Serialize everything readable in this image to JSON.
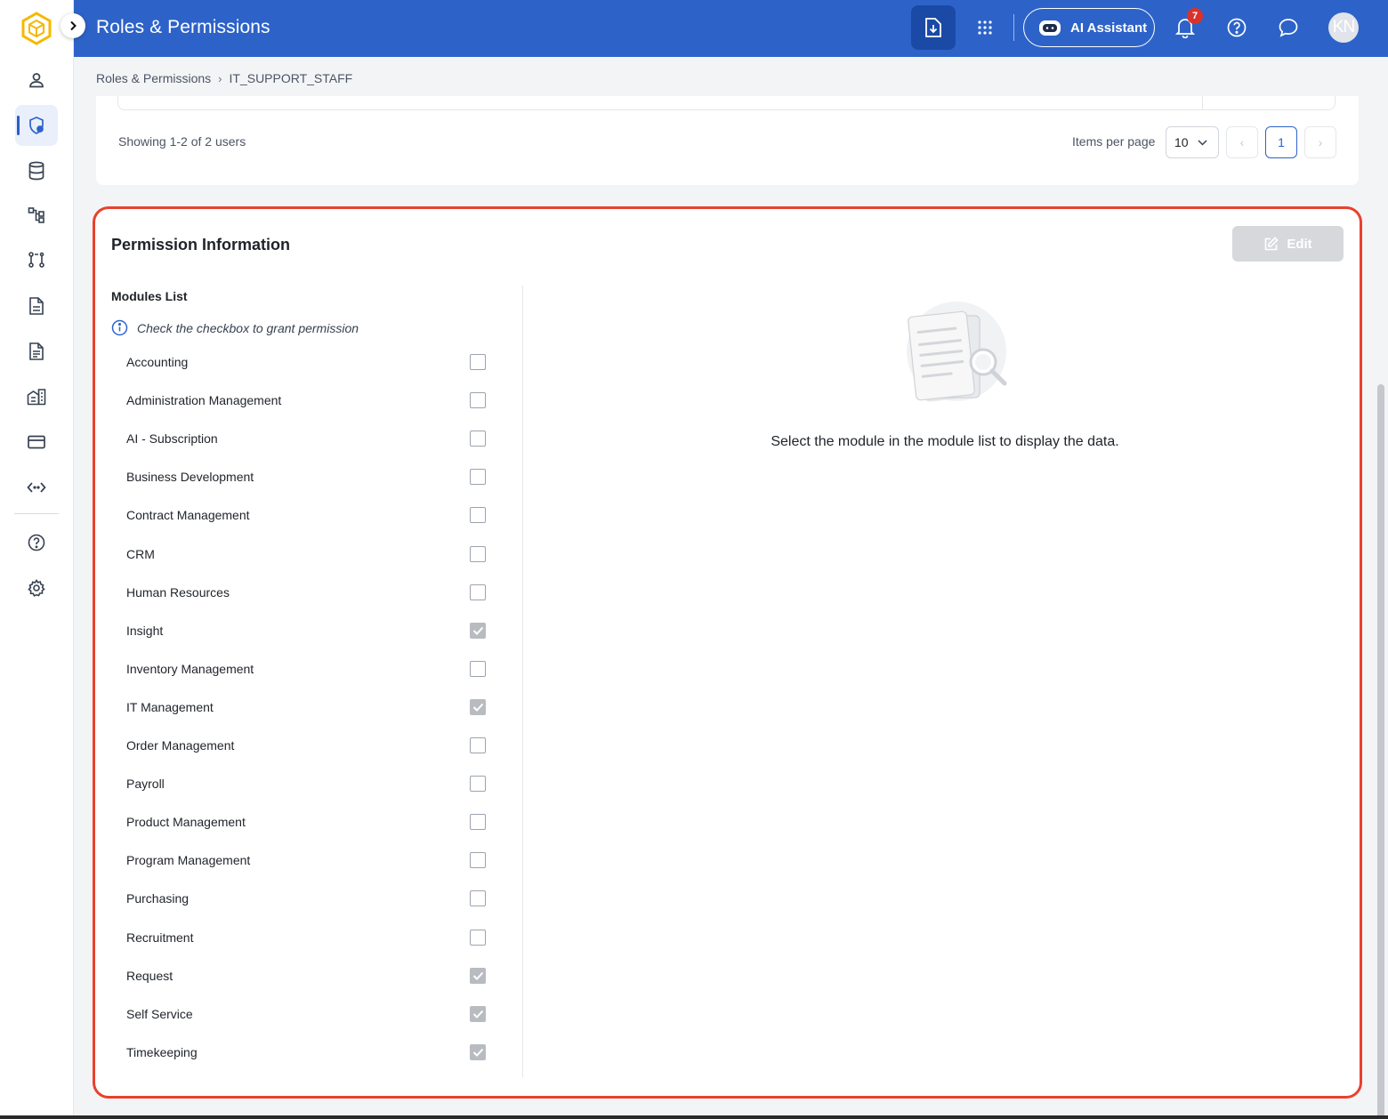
{
  "header": {
    "title": "Roles & Permissions",
    "ai_assistant_label": "AI Assistant",
    "notification_count": "7",
    "avatar_initials": "KN"
  },
  "breadcrumb": {
    "root": "Roles & Permissions",
    "separator": "›",
    "current": "IT_SUPPORT_STAFF"
  },
  "users_pagination": {
    "showing_text": "Showing 1-2 of 2 users",
    "items_per_page_label": "Items per page",
    "items_per_page_value": "10",
    "prev_glyph": "‹",
    "current_page": "1",
    "next_glyph": "›"
  },
  "permission": {
    "heading": "Permission Information",
    "edit_label": "Edit",
    "modules_label": "Modules List",
    "hint": "Check the checkbox to grant permission",
    "empty_message": "Select the module in the module list to display the data.",
    "modules": [
      {
        "label": "Accounting",
        "checked": false
      },
      {
        "label": "Administration Management",
        "checked": false
      },
      {
        "label": "AI - Subscription",
        "checked": false
      },
      {
        "label": "Business Development",
        "checked": false
      },
      {
        "label": "Contract Management",
        "checked": false
      },
      {
        "label": "CRM",
        "checked": false
      },
      {
        "label": "Human Resources",
        "checked": false
      },
      {
        "label": "Insight",
        "checked": true
      },
      {
        "label": "Inventory Management",
        "checked": false
      },
      {
        "label": "IT Management",
        "checked": true
      },
      {
        "label": "Order Management",
        "checked": false
      },
      {
        "label": "Payroll",
        "checked": false
      },
      {
        "label": "Product Management",
        "checked": false
      },
      {
        "label": "Program Management",
        "checked": false
      },
      {
        "label": "Purchasing",
        "checked": false
      },
      {
        "label": "Recruitment",
        "checked": false
      },
      {
        "label": "Request",
        "checked": true
      },
      {
        "label": "Self Service",
        "checked": true
      },
      {
        "label": "Timekeeping",
        "checked": true
      }
    ]
  },
  "sidebar": {
    "items": [
      {
        "icon": "user-icon"
      },
      {
        "icon": "shield-user-icon",
        "active": true
      },
      {
        "icon": "database-icon"
      },
      {
        "icon": "workflow-icon"
      },
      {
        "icon": "git-pull-request-icon"
      },
      {
        "icon": "document-icon"
      },
      {
        "icon": "document-list-icon"
      },
      {
        "icon": "building-icon"
      },
      {
        "icon": "credit-card-icon"
      },
      {
        "icon": "api-code-icon"
      },
      {
        "icon": "help-icon"
      },
      {
        "icon": "settings-gear-icon"
      }
    ]
  },
  "colors": {
    "brand_blue": "#2d63c8",
    "highlight_border": "#e8412e",
    "badge_red": "#d9322b",
    "checked_gray": "#b8bbc0"
  }
}
